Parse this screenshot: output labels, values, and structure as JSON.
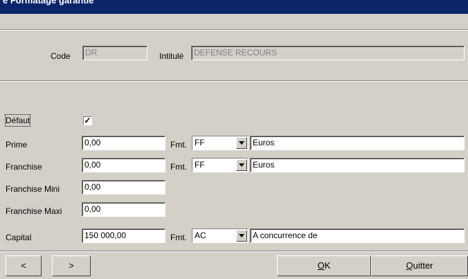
{
  "window": {
    "title": "e Formatage garantie"
  },
  "header": {
    "code_label": "Code",
    "code_value": "DR",
    "intitule_label": "Intitulé",
    "intitule_value": "DEFENSE RECOURS"
  },
  "form": {
    "defaut": {
      "label": "Défaut",
      "checked": true,
      "check_glyph": "✓"
    },
    "prime": {
      "label": "Prime",
      "value": "0,00",
      "fmt_label": "Fmt.",
      "fmt_value": "FF",
      "desc": "Euros"
    },
    "franchise": {
      "label": "Franchise",
      "value": "0,00",
      "fmt_label": "Fmt.",
      "fmt_value": "FF",
      "desc": "Euros"
    },
    "franchise_mini": {
      "label": "Franchise Mini",
      "value": "0,00"
    },
    "franchise_maxi": {
      "label": "Franchise Maxi",
      "value": "0,00"
    },
    "capital": {
      "label": "Capital",
      "value": "150 000,00",
      "fmt_label": "Fmt.",
      "fmt_value": "AC",
      "desc": "A concurrence de"
    }
  },
  "footer": {
    "prev_label": "<",
    "next_label": ">",
    "ok_key": "O",
    "ok_rest": "K",
    "quit_key": "Q",
    "quit_rest": "uitter"
  },
  "icons": {
    "dropdown": "chevron-down-icon",
    "check": "check-icon"
  }
}
